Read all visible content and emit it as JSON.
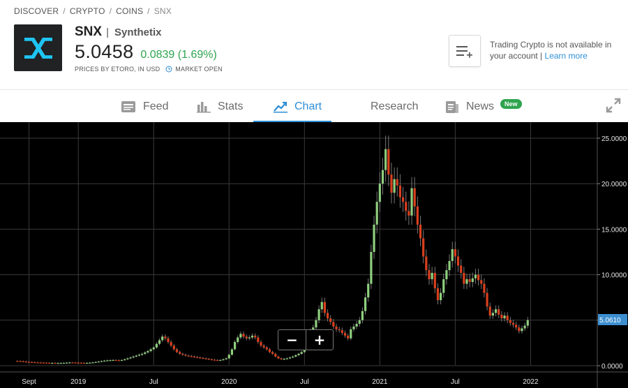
{
  "breadcrumb": [
    "DISCOVER",
    "CRYPTO",
    "COINS",
    "SNX"
  ],
  "asset": {
    "ticker": "SNX",
    "separator": "|",
    "name": "Synthetix",
    "price": "5.0458",
    "change": "0.0839 (1.69%)",
    "source": "PRICES BY ETORO, IN USD",
    "market_status": "MARKET OPEN"
  },
  "notice": {
    "text": "Trading Crypto is not available in your account |",
    "link": "Learn more"
  },
  "tabs": [
    {
      "label": "Feed",
      "icon": "feed-icon"
    },
    {
      "label": "Stats",
      "icon": "stats-icon"
    },
    {
      "label": "Chart",
      "icon": "chart-icon"
    },
    {
      "label": "Research",
      "icon": ""
    },
    {
      "label": "News",
      "icon": "news-icon",
      "badge": "New"
    }
  ],
  "active_tab": "Chart",
  "colors": {
    "up": "#8fcf7e",
    "down": "#d8401e",
    "accent": "#2f8fd6",
    "positive_text": "#2fa44f",
    "last_price_tag": "#3d8fd0"
  },
  "zoom": {
    "minus": "−",
    "plus": "+"
  },
  "chart_data": {
    "type": "candlestick",
    "y_ticks": [
      "25.0000",
      "20.0000",
      "15.0000",
      "10.0000",
      "5.0000",
      "0.0000"
    ],
    "y_tick_values": [
      25,
      20,
      15,
      10,
      5,
      0
    ],
    "ylim": [
      -0.1,
      25.2
    ],
    "x_ticks": [
      "Sept",
      "2019",
      "Jul",
      "2020",
      "Jul",
      "2021",
      "Jul",
      "2022"
    ],
    "x_tick_weeks": [
      4,
      21,
      47,
      73,
      99,
      125,
      151,
      177
    ],
    "x_range_weeks": [
      -6,
      200
    ],
    "last_price": "5.0610",
    "last_price_value": 5.061,
    "weekly_close": [
      0.5,
      0.48,
      0.45,
      0.42,
      0.4,
      0.38,
      0.36,
      0.34,
      0.33,
      0.32,
      0.31,
      0.3,
      0.3,
      0.29,
      0.29,
      0.3,
      0.31,
      0.33,
      0.35,
      0.34,
      0.33,
      0.32,
      0.31,
      0.3,
      0.31,
      0.33,
      0.36,
      0.4,
      0.45,
      0.5,
      0.55,
      0.58,
      0.6,
      0.62,
      0.6,
      0.58,
      0.62,
      0.7,
      0.8,
      0.9,
      1.0,
      1.1,
      1.2,
      1.3,
      1.45,
      1.6,
      1.8,
      2.0,
      2.4,
      2.8,
      3.2,
      3.0,
      2.6,
      2.2,
      1.8,
      1.5,
      1.3,
      1.2,
      1.1,
      1.05,
      1.0,
      0.95,
      0.9,
      0.85,
      0.8,
      0.75,
      0.7,
      0.65,
      0.62,
      0.6,
      0.62,
      0.7,
      0.8,
      1.2,
      1.8,
      2.6,
      3.1,
      3.5,
      3.2,
      3.0,
      3.1,
      3.3,
      3.1,
      2.6,
      2.2,
      2.0,
      1.8,
      1.5,
      1.3,
      1.0,
      0.8,
      0.7,
      0.75,
      0.8,
      0.9,
      1.0,
      1.15,
      1.3,
      1.5,
      2.2,
      3.0,
      3.8,
      4.2,
      5.0,
      6.2,
      7.0,
      5.8,
      5.2,
      4.8,
      4.3,
      4.0,
      3.9,
      3.6,
      3.3,
      3.0,
      4.0,
      4.3,
      4.6,
      5.0,
      6.0,
      7.5,
      9.0,
      12.5,
      15.5,
      18.0,
      20.0,
      21.5,
      23.8,
      21.0,
      19.0,
      20.5,
      19.8,
      18.5,
      18.0,
      17.0,
      16.5,
      19.5,
      17.5,
      15.5,
      14.0,
      12.0,
      10.5,
      9.5,
      10.2,
      8.5,
      7.2,
      8.0,
      9.5,
      10.5,
      11.5,
      12.8,
      12.0,
      11.0,
      10.2,
      9.0,
      9.5,
      9.2,
      9.6,
      10.0,
      9.4,
      9.0,
      8.0,
      6.5,
      5.5,
      5.8,
      6.2,
      5.6,
      5.2,
      5.5,
      5.0,
      4.7,
      4.5,
      4.2,
      3.8,
      4.1,
      4.4,
      5.0
    ]
  }
}
